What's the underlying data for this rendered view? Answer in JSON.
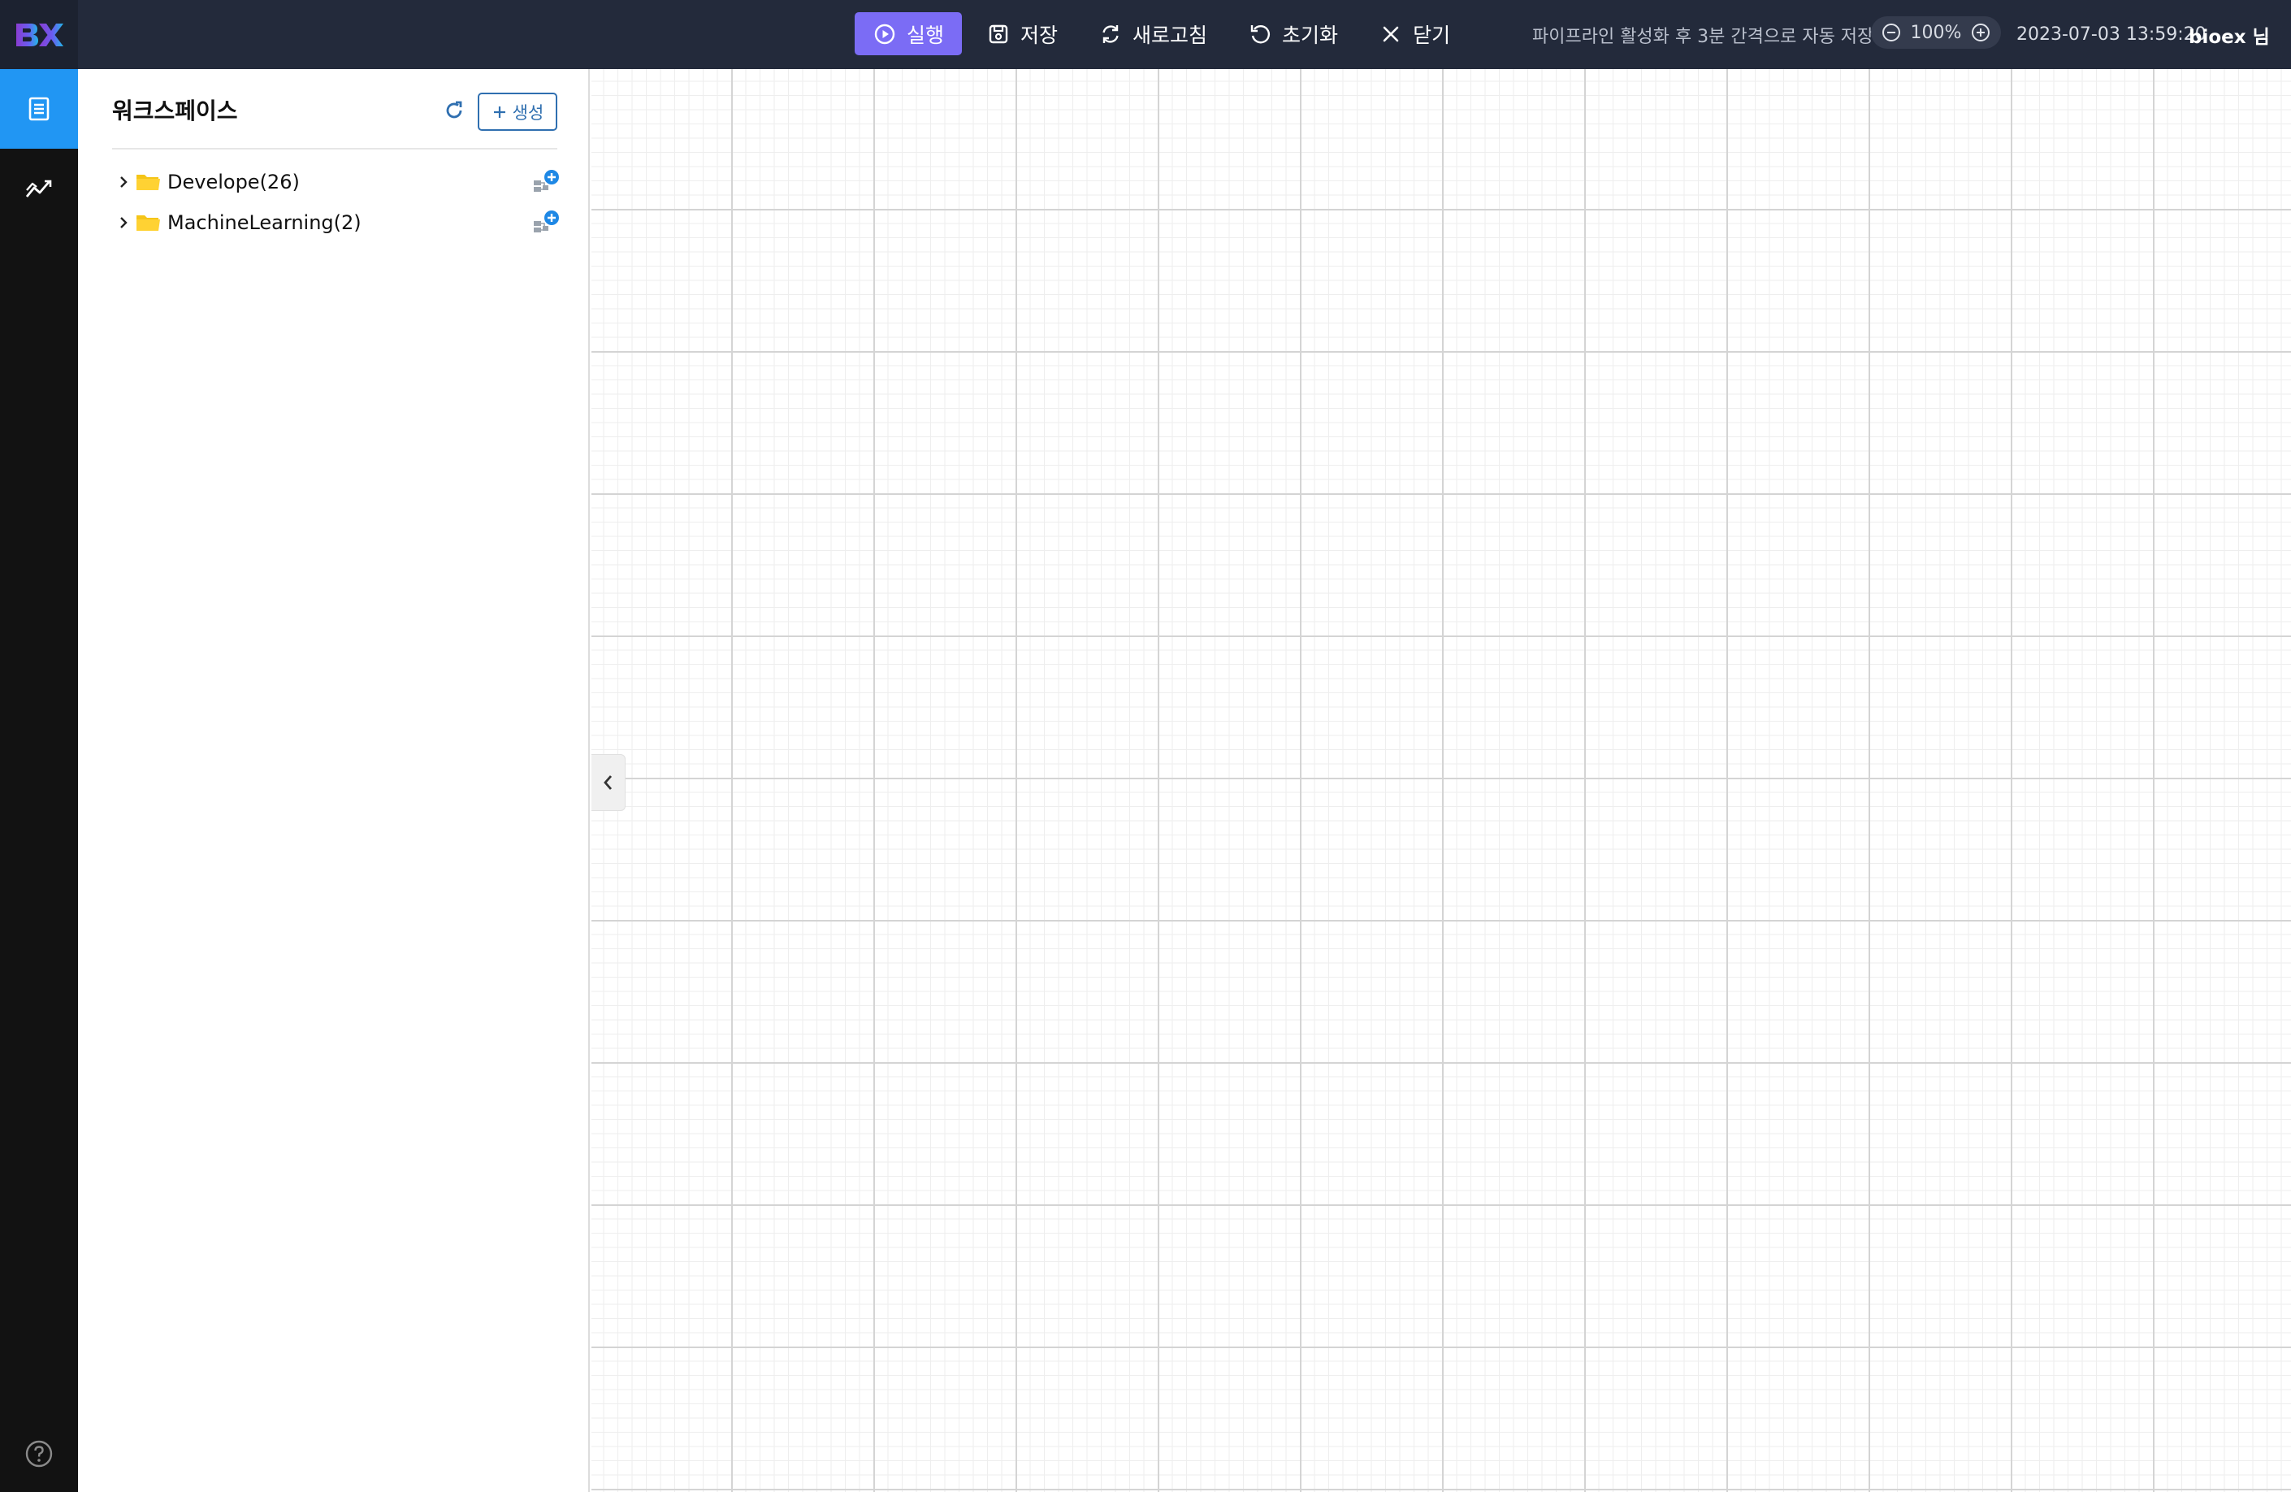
{
  "app": {
    "logo_text": "BX"
  },
  "toolbar": {
    "run_label": "실행",
    "save_label": "저장",
    "refresh_label": "새로고침",
    "reset_label": "초기화",
    "close_label": "닫기"
  },
  "status": {
    "autosave_notice": "파이프라인 활성화 후 3분 간격으로 자동 저장",
    "zoom_level": "100%",
    "datetime": "2023-07-03 13:59:20",
    "username": "bioex 님"
  },
  "sidebar": {
    "items": [
      {
        "name": "workspace",
        "icon": "document-list-icon",
        "active": true
      },
      {
        "name": "analytics",
        "icon": "chart-line-icon",
        "active": false
      }
    ],
    "help_icon": "help-icon"
  },
  "workspace": {
    "title": "워크스페이스",
    "create_label": "생성",
    "folders": [
      {
        "label": "Develope(26)"
      },
      {
        "label": "MachineLearning(2)"
      }
    ]
  },
  "colors": {
    "topbar_bg": "#232a3b",
    "run_button": "#7b6cf5",
    "rail_bg": "#121212",
    "rail_active": "#2196f3",
    "create_border": "#2f6fb0",
    "folder_yellow": "#f5c518"
  }
}
